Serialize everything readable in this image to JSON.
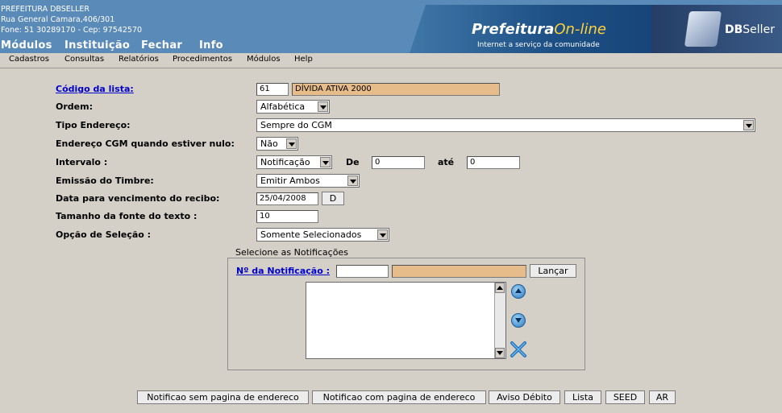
{
  "header": {
    "org_name": "PREFEITURA DBSELLER",
    "address": "Rua General Camara,406/301",
    "phone": "Fone: 51 30289170  -  Cep: 97542570",
    "main_menu": [
      "Módulos",
      "Instituição",
      "Fechar",
      "Info"
    ],
    "brand_name_a": "Prefeitura",
    "brand_name_b": "On-line",
    "brand_tagline": "Internet a serviço da comunidade",
    "logo_text_a": "DB",
    "logo_text_b": "Seller"
  },
  "submenu": [
    "Cadastros",
    "Consultas",
    "Relatórios",
    "Procedimentos",
    "Módulos",
    "Help"
  ],
  "form": {
    "codigo_label": "Código da lista:",
    "codigo_value": "61",
    "codigo_desc": "DÍVIDA ATIVA 2000",
    "ordem_label": "Ordem:",
    "ordem_value": "Alfabética",
    "tipo_label": "Tipo Endereço:",
    "tipo_value": "Sempre do CGM",
    "endcgm_label": "Endereço CGM quando estiver nulo:",
    "endcgm_value": "Não",
    "intervalo_label": "Intervalo :",
    "intervalo_value": "Notificação",
    "de_label": "De",
    "de_value": "0",
    "ate_label": "até",
    "ate_value": "0",
    "emissao_label": "Emissão do Timbre:",
    "emissao_value": "Emitir Ambos",
    "data_label": "Data para vencimento do recibo:",
    "data_value": "25/04/2008",
    "data_btn": "D",
    "tamanho_label": "Tamanho da fonte do texto :",
    "tamanho_value": "10",
    "opcao_label": "Opção de Seleção :",
    "opcao_value": "Somente Selecionados"
  },
  "fieldset": {
    "legend": "Selecione as Notificações",
    "notif_label": "Nº da Notificação :",
    "notif_value": "",
    "notif_desc": "",
    "lancar_btn": "Lançar"
  },
  "buttons": [
    "Notificao sem pagina de endereco",
    "Notificao com pagina de endereco",
    "Aviso Débito",
    "Lista",
    "SEED",
    "AR"
  ]
}
